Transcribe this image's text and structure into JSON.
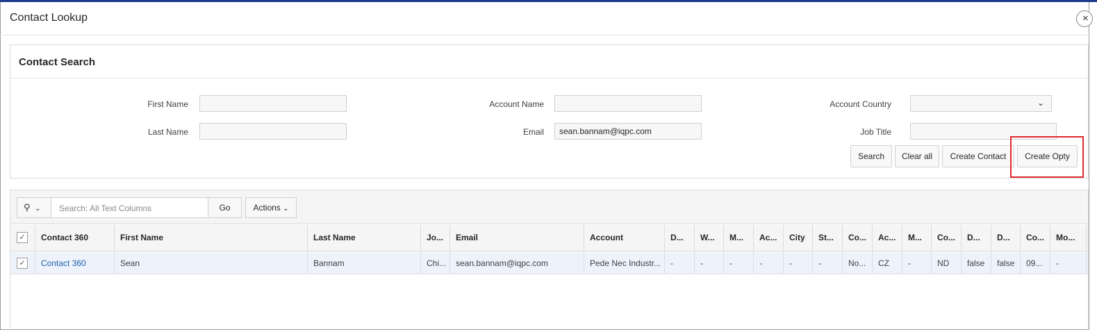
{
  "dialog": {
    "title": "Contact Lookup",
    "close_glyph": "×"
  },
  "search_region": {
    "title": "Contact Search",
    "fields": {
      "first_name": {
        "label": "First Name",
        "value": ""
      },
      "last_name": {
        "label": "Last Name",
        "value": ""
      },
      "account_name": {
        "label": "Account Name",
        "value": ""
      },
      "email": {
        "label": "Email",
        "value": "sean.bannam@iqpc.com"
      },
      "account_country": {
        "label": "Account Country",
        "value": ""
      },
      "job_title": {
        "label": "Job Title",
        "value": ""
      }
    },
    "buttons": {
      "search": "Search",
      "clear_all": "Clear all",
      "create_contact": "Create Contact",
      "create_opty": "Create Opty"
    },
    "highlight_color": "#e0282c"
  },
  "report": {
    "toolbar": {
      "search_placeholder": "Search: All Text Columns",
      "go": "Go",
      "actions": "Actions"
    },
    "header_checkbox": "✓",
    "columns": [
      "Contact 360",
      "First Name",
      "Last Name",
      "Jo...",
      "Email",
      "Account",
      "D...",
      "W...",
      "M...",
      "Ac...",
      "City",
      "St...",
      "Co...",
      "Ac...",
      "M...",
      "Co...",
      "D...",
      "D...",
      "Co...",
      "Mo..."
    ],
    "rows": [
      {
        "checked": "✓",
        "cells": [
          "Contact 360",
          "Sean",
          "Bannam",
          "Chi...",
          "sean.bannam@iqpc.com",
          "Pede Nec Industr...",
          "-",
          "-",
          "-",
          "-",
          "-",
          "-",
          "No...",
          "CZ",
          "-",
          "ND",
          "false",
          "false",
          "09...",
          "-"
        ]
      }
    ]
  },
  "colors": {
    "link": "#1f5fad",
    "row_selected": "#eef3fb",
    "top_strip": "#1f3a8a"
  }
}
